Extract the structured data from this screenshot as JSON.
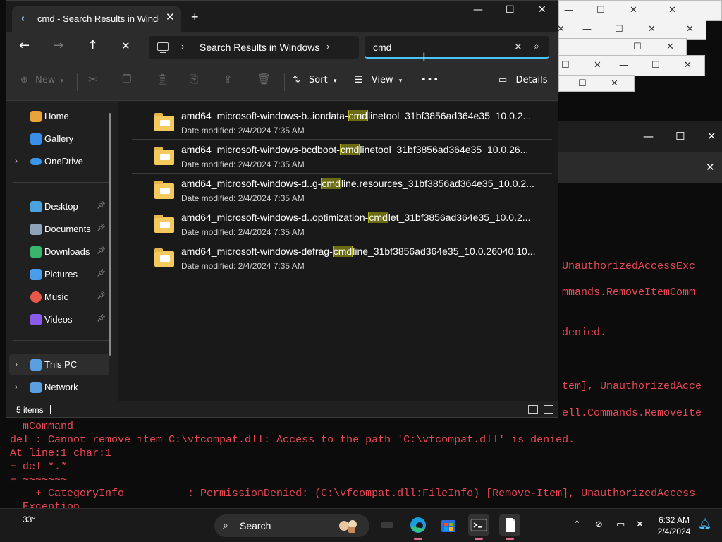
{
  "explorer": {
    "tab_title": "cmd - Search Results in Windo",
    "tab_close": "✕",
    "new_tab": "+",
    "window_controls": {
      "minimize": "—",
      "maximize": "☐",
      "close": "✕"
    },
    "nav": {
      "back": "←",
      "forward": "→",
      "up": "↑",
      "stop": "✕"
    },
    "address": {
      "breadcrumb": "Search Results in Windows",
      "chevron": "›"
    },
    "search": {
      "value": "cmd",
      "clear": "✕",
      "icon": "⌕"
    },
    "toolbar": {
      "new_label": "New",
      "sort_label": "Sort",
      "view_label": "View",
      "more_label": "•••",
      "details_label": "Details"
    },
    "sidebar": {
      "items": [
        {
          "label": "Home",
          "icon": "home-icon",
          "color": "#e8a33a"
        },
        {
          "label": "Gallery",
          "icon": "gallery-icon",
          "color": "#3a8ee8"
        },
        {
          "label": "OneDrive",
          "icon": "onedrive-icon",
          "color": "#3a96e8"
        },
        {
          "label": "Desktop",
          "icon": "desktop-icon",
          "color": "#4aa3df"
        },
        {
          "label": "Documents",
          "icon": "documents-icon",
          "color": "#8ea2b8"
        },
        {
          "label": "Downloads",
          "icon": "downloads-icon",
          "color": "#3bb56b"
        },
        {
          "label": "Pictures",
          "icon": "pictures-icon",
          "color": "#4a9de8"
        },
        {
          "label": "Music",
          "icon": "music-icon",
          "color": "#e8584a"
        },
        {
          "label": "Videos",
          "icon": "videos-icon",
          "color": "#8a5ae8"
        },
        {
          "label": "This PC",
          "icon": "pc-icon",
          "color": "#5aa0e0"
        },
        {
          "label": "Network",
          "icon": "network-icon",
          "color": "#5aa0e0"
        }
      ]
    },
    "files": [
      {
        "pre": "amd64_microsoft-windows-b..iondata-",
        "hl": "cmd",
        "post": "linetool_31bf3856ad364e35_10.0.2...",
        "meta": "Date modified: 2/4/2024 7:35 AM"
      },
      {
        "pre": "amd64_microsoft-windows-bcdboot-",
        "hl": "cmd",
        "post": "linetool_31bf3856ad364e35_10.0.26...",
        "meta": "Date modified: 2/4/2024 7:35 AM"
      },
      {
        "pre": "amd64_microsoft-windows-d..g-",
        "hl": "cmd",
        "post": "line.resources_31bf3856ad364e35_10.0.2...",
        "meta": "Date modified: 2/4/2024 7:35 AM"
      },
      {
        "pre": "amd64_microsoft-windows-d..optimization-",
        "hl": "cmd",
        "post": "let_31bf3856ad364e35_10.0.2...",
        "meta": "Date modified: 2/4/2024 7:35 AM"
      },
      {
        "pre": "amd64_microsoft-windows-defrag-",
        "hl": "cmd",
        "post": "line_31bf3856ad364e35_10.0.26040.10...",
        "meta": "Date modified: 2/4/2024 7:35 AM"
      }
    ],
    "status": {
      "count": "5 items"
    }
  },
  "terminal": {
    "lines": [
      {
        "text": "UnauthorizedAccessExc"
      },
      {
        "text": "mmands.RemoveItemComm"
      },
      {
        "text": "denied."
      },
      {
        "text": "tem], UnauthorizedAcce"
      },
      {
        "text": "ell.Commands.RemoveIte"
      },
      {
        "text": "  mCommand"
      },
      {
        "text": "del : Cannot remove item C:\\vfcompat.dll: Access to the path 'C:\\vfcompat.dll' is denied."
      },
      {
        "text": "At line:1 char:1"
      },
      {
        "text": "+ del *.*"
      },
      {
        "text": "+ ~~~~~~~"
      },
      {
        "text": "    + CategoryInfo          : PermissionDenied: (C:\\vfcompat.dll:FileInfo) [Remove-Item], UnauthorizedAccess"
      },
      {
        "text": "  Exception"
      }
    ]
  },
  "taskbar": {
    "weather": "33°",
    "search_label": "Search",
    "clock_time": "6:32 AM",
    "clock_date": "2/4/2024"
  }
}
